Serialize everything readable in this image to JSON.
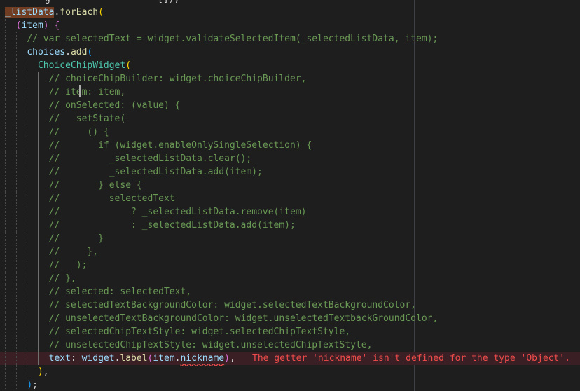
{
  "editor": {
    "top_fragment_left": "g",
    "top_fragment_right": "[]);",
    "error_message": "The getter 'nickname' isn't defined for the type 'Object'.",
    "colors": {
      "background": "#1e1e1e",
      "comment": "#6a9955",
      "variable": "#9cdcfe",
      "function": "#dcdcaa",
      "class": "#4ec9b0",
      "keyword": "#c586c0",
      "bracket_gold": "#ffd700",
      "bracket_orchid": "#da70d6",
      "bracket_blue": "#179fff",
      "error": "#f14c4c"
    },
    "lines": [
      {
        "indent": 0,
        "cls": "",
        "segs": [
          [
            "_listData",
            "var sel"
          ],
          [
            ".",
            "pl"
          ],
          [
            "forEach",
            "fn"
          ],
          [
            "(",
            "p1"
          ]
        ]
      },
      {
        "indent": 1,
        "cls": "",
        "segs": [
          [
            "(",
            "p2"
          ],
          [
            "item",
            "var"
          ],
          [
            ")",
            "p2"
          ],
          [
            " ",
            "pl"
          ],
          [
            "{",
            "p2"
          ]
        ]
      },
      {
        "indent": 2,
        "cls": "",
        "segs": [
          [
            "// var selectedText = widget.validateSelectedItem(_selectedListData, item);",
            "cm"
          ]
        ]
      },
      {
        "indent": 2,
        "cls": "",
        "segs": [
          [
            "choices",
            "var"
          ],
          [
            ".",
            "pl"
          ],
          [
            "add",
            "fn"
          ],
          [
            "(",
            "p3"
          ]
        ]
      },
      {
        "indent": 3,
        "cls": "",
        "segs": [
          [
            "ChoiceChipWidget",
            "cls"
          ],
          [
            "(",
            "p1"
          ]
        ]
      },
      {
        "indent": 4,
        "cls": "",
        "segs": [
          [
            "// choiceChipBuilder: widget.choiceChipBuilder,",
            "cm"
          ]
        ]
      },
      {
        "indent": 4,
        "cls": "",
        "segs": [
          [
            "// item: item,",
            "cm"
          ]
        ]
      },
      {
        "indent": 4,
        "cls": "",
        "segs": [
          [
            "// onSelected: (value) {",
            "cm"
          ]
        ]
      },
      {
        "indent": 4,
        "cls": "",
        "segs": [
          [
            "//   setState(",
            "cm"
          ]
        ]
      },
      {
        "indent": 4,
        "cls": "",
        "segs": [
          [
            "//     () {",
            "cm"
          ]
        ]
      },
      {
        "indent": 4,
        "cls": "",
        "segs": [
          [
            "//       if (widget.enableOnlySingleSelection) {",
            "cm"
          ]
        ]
      },
      {
        "indent": 4,
        "cls": "",
        "segs": [
          [
            "//         _selectedListData.clear();",
            "cm"
          ]
        ]
      },
      {
        "indent": 4,
        "cls": "",
        "segs": [
          [
            "//         _selectedListData.add(item);",
            "cm"
          ]
        ]
      },
      {
        "indent": 4,
        "cls": "",
        "segs": [
          [
            "//       } else {",
            "cm"
          ]
        ]
      },
      {
        "indent": 4,
        "cls": "",
        "segs": [
          [
            "//         selectedText",
            "cm"
          ]
        ]
      },
      {
        "indent": 4,
        "cls": "",
        "segs": [
          [
            "//             ? _selectedListData.remove(item)",
            "cm"
          ]
        ]
      },
      {
        "indent": 4,
        "cls": "",
        "segs": [
          [
            "//             : _selectedListData.add(item);",
            "cm"
          ]
        ]
      },
      {
        "indent": 4,
        "cls": "",
        "segs": [
          [
            "//       }",
            "cm"
          ]
        ]
      },
      {
        "indent": 4,
        "cls": "",
        "segs": [
          [
            "//     },",
            "cm"
          ]
        ]
      },
      {
        "indent": 4,
        "cls": "",
        "segs": [
          [
            "//   );",
            "cm"
          ]
        ]
      },
      {
        "indent": 4,
        "cls": "",
        "segs": [
          [
            "// },",
            "cm"
          ]
        ]
      },
      {
        "indent": 4,
        "cls": "",
        "segs": [
          [
            "// selected: selectedText,",
            "cm"
          ]
        ]
      },
      {
        "indent": 4,
        "cls": "",
        "segs": [
          [
            "// selectedTextBackgroundColor: widget.selectedTextBackgroundColor,",
            "cm"
          ]
        ]
      },
      {
        "indent": 4,
        "cls": "",
        "segs": [
          [
            "// unselectedTextBackgroundColor: widget.unselectedTextbackGroundColor,",
            "cm"
          ]
        ]
      },
      {
        "indent": 4,
        "cls": "",
        "segs": [
          [
            "// selectedChipTextStyle: widget.selectedChipTextStyle,",
            "cm"
          ]
        ]
      },
      {
        "indent": 4,
        "cls": "",
        "segs": [
          [
            "// unselectedChipTextStyle: widget.unselectedChipTextStyle,",
            "cm"
          ]
        ]
      },
      {
        "indent": 4,
        "cls": "err",
        "segs": [
          [
            "text",
            "var"
          ],
          [
            ": ",
            "pl"
          ],
          [
            "widget",
            "var"
          ],
          [
            ".",
            "pl"
          ],
          [
            "label",
            "fn"
          ],
          [
            "(",
            "p2"
          ],
          [
            "item",
            "var"
          ],
          [
            ".",
            "pl"
          ],
          [
            "nickname",
            "var squig"
          ],
          [
            ")",
            "p2"
          ],
          [
            ",",
            "pl"
          ]
        ]
      },
      {
        "indent": 3,
        "cls": "",
        "segs": [
          [
            ")",
            "p1"
          ],
          [
            ",",
            "pl"
          ]
        ]
      },
      {
        "indent": 2,
        "cls": "",
        "segs": [
          [
            ")",
            "p3"
          ],
          [
            ";",
            "pl"
          ]
        ]
      }
    ]
  }
}
